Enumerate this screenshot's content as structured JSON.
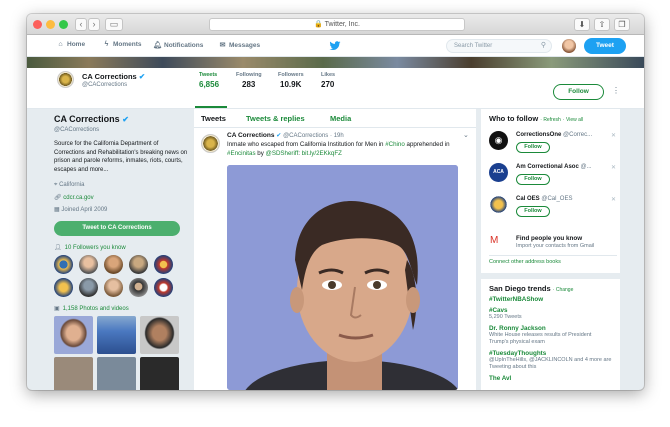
{
  "browser": {
    "url": "Twitter, Inc.",
    "back_icon": "chevron-left",
    "forward_icon": "chevron-right"
  },
  "nav": {
    "home": "Home",
    "moments": "Moments",
    "notifications": "Notifications",
    "messages": "Messages",
    "search_placeholder": "Search Twitter",
    "tweet_button": "Tweet"
  },
  "profile": {
    "name": "CA Corrections",
    "handle": "@CACorrections",
    "bio": "Source for the California Department of Corrections and Rehabilitation's breaking news on prison and parole reforms, inmates, riots, courts, escapes and more...",
    "location": "California",
    "website": "cdcr.ca.gov",
    "joined": "Joined April 2009",
    "tweet_to": "Tweet to CA Corrections",
    "followers_you_know": "10 Followers you know",
    "photos_videos": "1,158 Photos and videos",
    "follow": "Follow"
  },
  "stats": [
    {
      "label": "Tweets",
      "value": "6,856"
    },
    {
      "label": "Following",
      "value": "283"
    },
    {
      "label": "Followers",
      "value": "10.9K"
    },
    {
      "label": "Likes",
      "value": "270"
    }
  ],
  "tabs": [
    "Tweets",
    "Tweets & replies",
    "Media"
  ],
  "tweet": {
    "name": "CA Corrections",
    "handle": "@CACorrections",
    "time": "19h",
    "text_1": "Inmate who escaped from California Institution for Men in ",
    "hashtag_1": "#Chino",
    "text_2": " apprehended in ",
    "hashtag_2": "#Encinitas",
    "text_3": " by ",
    "mention": "@SDSheriff",
    "link": "bit.ly/2EKkqFZ"
  },
  "who_to_follow": {
    "title": "Who to follow",
    "refresh": "Refresh",
    "view_all": "View all",
    "items": [
      {
        "name": "CorrectionsOne",
        "handle": "@Correc...",
        "button": "Follow"
      },
      {
        "name": "Am Correctional Asoc",
        "handle": "@...",
        "button": "Follow"
      },
      {
        "name": "Cal OES",
        "handle": "@Cal_OES",
        "button": "Follow"
      }
    ],
    "find_title": "Find people you know",
    "find_sub": "Import your contacts from Gmail",
    "connect_other": "Connect other address books"
  },
  "trends": {
    "title": "San Diego trends",
    "change": "Change",
    "items": [
      {
        "tag": "#TwitterNBAShow",
        "sub": ""
      },
      {
        "tag": "#Cavs",
        "sub": "5,290 Tweets"
      },
      {
        "tag": "Dr. Ronny Jackson",
        "sub": "White House releases results of President Trump's physical exam"
      },
      {
        "tag": "#TuesdayThoughts",
        "sub": "@UpInTheHills, @JACKLINCOLN and 4 more are Tweeting about this"
      },
      {
        "tag": "The Avl",
        "sub": ""
      }
    ]
  },
  "colors": {
    "accent": "#1b8a3a",
    "twitter_blue": "#1da1f2"
  }
}
